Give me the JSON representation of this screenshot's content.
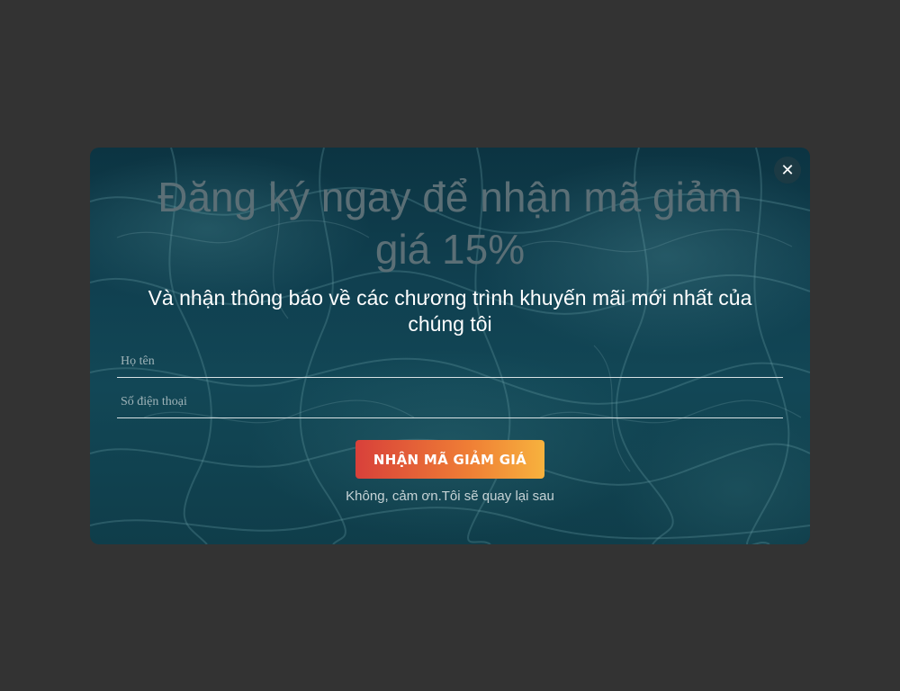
{
  "popup": {
    "close_icon": "close-icon",
    "close_glyph": "✕",
    "title": "Đăng ký ngay để nhận mã giảm giá 15%",
    "subtitle": "Và nhận thông báo về các chương trình khuyến mãi mới nhất của chúng tôi",
    "fields": {
      "name": {
        "placeholder": "Họ tên",
        "value": ""
      },
      "phone": {
        "placeholder": "Số điện thoại",
        "value": ""
      }
    },
    "submit_label": "NHẬN MÃ GIẢM GIÁ",
    "decline_label": "Không, cảm ơn.Tôi sẽ quay lại sau"
  },
  "colors": {
    "overlay": "#333333",
    "cta_start": "#d8403a",
    "cta_end": "#f7b23e"
  }
}
